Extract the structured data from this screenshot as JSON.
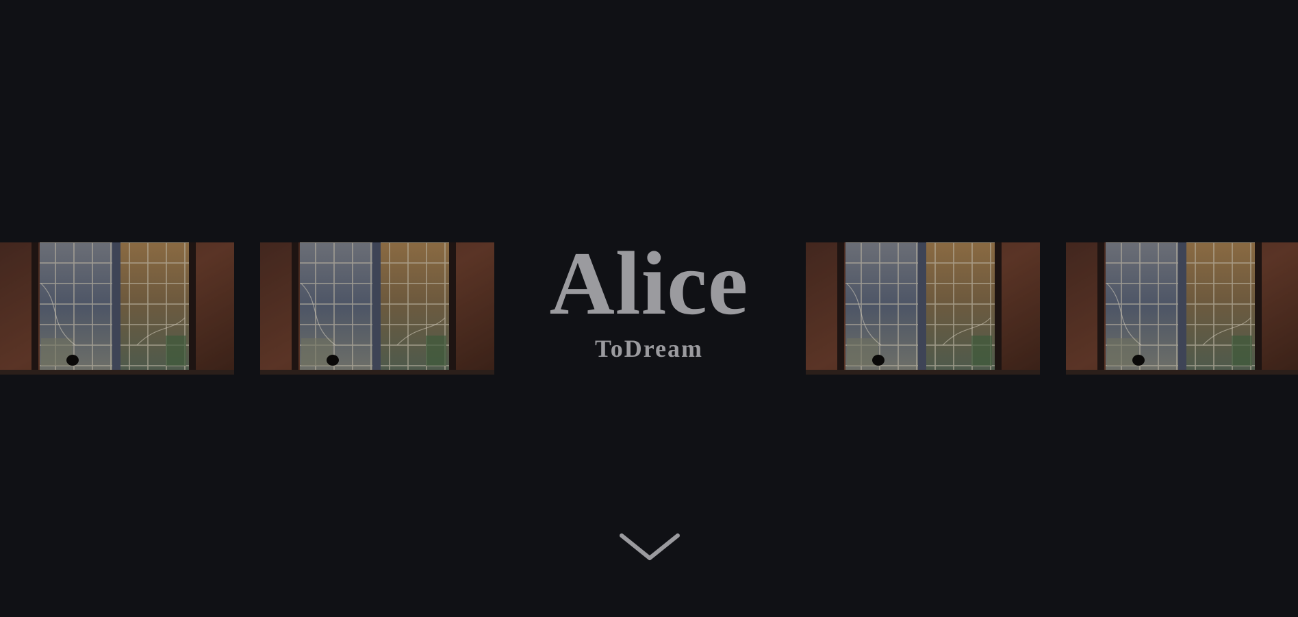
{
  "hero": {
    "title": "Alice",
    "subtitle": "ToDream"
  },
  "scroll_indicator": {
    "icon": "chevron-down-icon"
  },
  "colors": {
    "background": "#101115",
    "text": "#9b9b9f",
    "brick": "#5a3628",
    "glass_blue": "#5d6778",
    "glass_amber": "#8a6a40"
  }
}
